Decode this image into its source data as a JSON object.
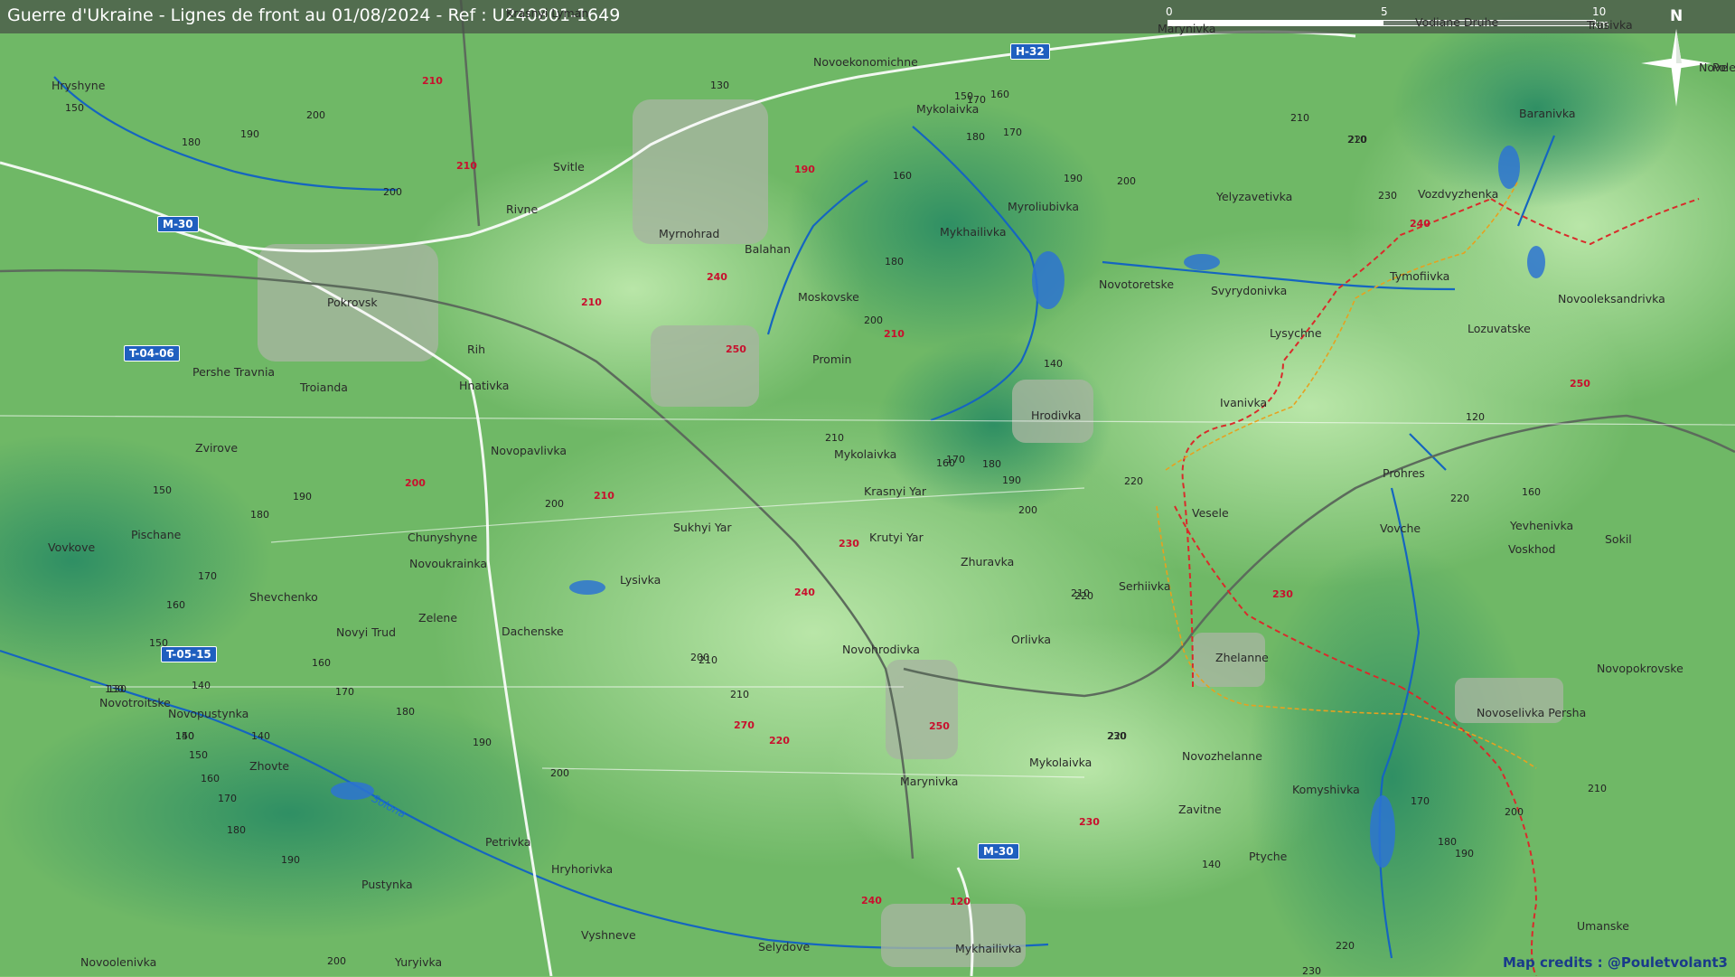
{
  "header": {
    "title": "Guerre d'Ukraine - Lignes de front au 01/08/2024 - Ref : U240801-1649"
  },
  "scale": {
    "zero": "0",
    "mid": "5",
    "end": "10 km"
  },
  "north_label": "N",
  "credits": "Map credits : @Pouletvolant3",
  "river_label": "Solona",
  "places": [
    "Hryshyne",
    "Svitle",
    "Rivne",
    "Myrnohrad",
    "Novoekonomichne",
    "Mykolaivka",
    "Myroliubivka",
    "Mykhailivka",
    "Balahan",
    "Moskovske",
    "Pokrovsk",
    "Rih",
    "Pershe Travnia",
    "Troianda",
    "Hnativka",
    "Novopavlivka",
    "Zvirove",
    "Promin",
    "Hrodivka",
    "Mykolaivka",
    "Krasnyi Yar",
    "Krutyi Yar",
    "Sukhyi Yar",
    "Zhuravka",
    "Chunyshyne",
    "Novoukrainka",
    "Pischane",
    "Vovkove",
    "Shevchenko",
    "Lysivka",
    "Dachenske",
    "Zelene",
    "Novyi Trud",
    "Novotroitske",
    "Novopustynka",
    "Zhovte",
    "Orlivka",
    "Novohrodivka",
    "Serhiivka",
    "Vesele",
    "Zhelanne",
    "Novotoretske",
    "Svyrydonivka",
    "Lysychne",
    "Ivanivka",
    "Yelyzavetivka",
    "Vozdvyzhenka",
    "Tymofiivka",
    "Lozuvatske",
    "Novooleksandrivka",
    "Baranivka",
    "Prohres",
    "Vovche",
    "Yevhenivka",
    "Voskhod",
    "Sokil",
    "Novopokrovske",
    "Novoselivka Persha",
    "Mykolaivka",
    "Marynivka",
    "Novozhelanne",
    "Komyshivka",
    "Zavitne",
    "Ptyche",
    "Petrivka",
    "Hryhorivka",
    "Pustynka",
    "Novoolenivka",
    "Yuryivka",
    "Vyshneve",
    "Selydove",
    "Mykhailivka",
    "Umanske",
    "Marynivka",
    "Vodiane Druhe",
    "Krasnyi Lyman",
    "Trasivka",
    "Nove",
    "Pole"
  ],
  "highways": [
    "H-32",
    "M-30",
    "T-04-06",
    "T-05-15",
    "M-30"
  ],
  "elevations": [
    "150",
    "180",
    "190",
    "200",
    "210",
    "210",
    "200",
    "130",
    "190",
    "240",
    "210",
    "250",
    "160",
    "180",
    "200",
    "210",
    "140",
    "150",
    "160",
    "170",
    "180",
    "190",
    "200",
    "210",
    "200",
    "210",
    "220",
    "250",
    "240",
    "230",
    "200",
    "210",
    "220",
    "230",
    "240",
    "160",
    "170",
    "180",
    "190",
    "200",
    "210",
    "220",
    "230",
    "150",
    "160",
    "170",
    "180",
    "190",
    "200",
    "140",
    "150",
    "160",
    "170",
    "180",
    "190",
    "200",
    "210",
    "220",
    "230",
    "140",
    "150",
    "160",
    "170",
    "180",
    "190",
    "200",
    "210",
    "220",
    "230",
    "240",
    "250",
    "270",
    "120",
    "130",
    "140",
    "150",
    "170",
    "210",
    "220",
    "160",
    "170",
    "180",
    "190",
    "200",
    "210",
    "220",
    "230",
    "120",
    "130",
    "140"
  ],
  "colors": {
    "front_line": "#d92b2b",
    "road": "#ffffff",
    "river": "#1565c0",
    "terrain": "#6fb866"
  }
}
